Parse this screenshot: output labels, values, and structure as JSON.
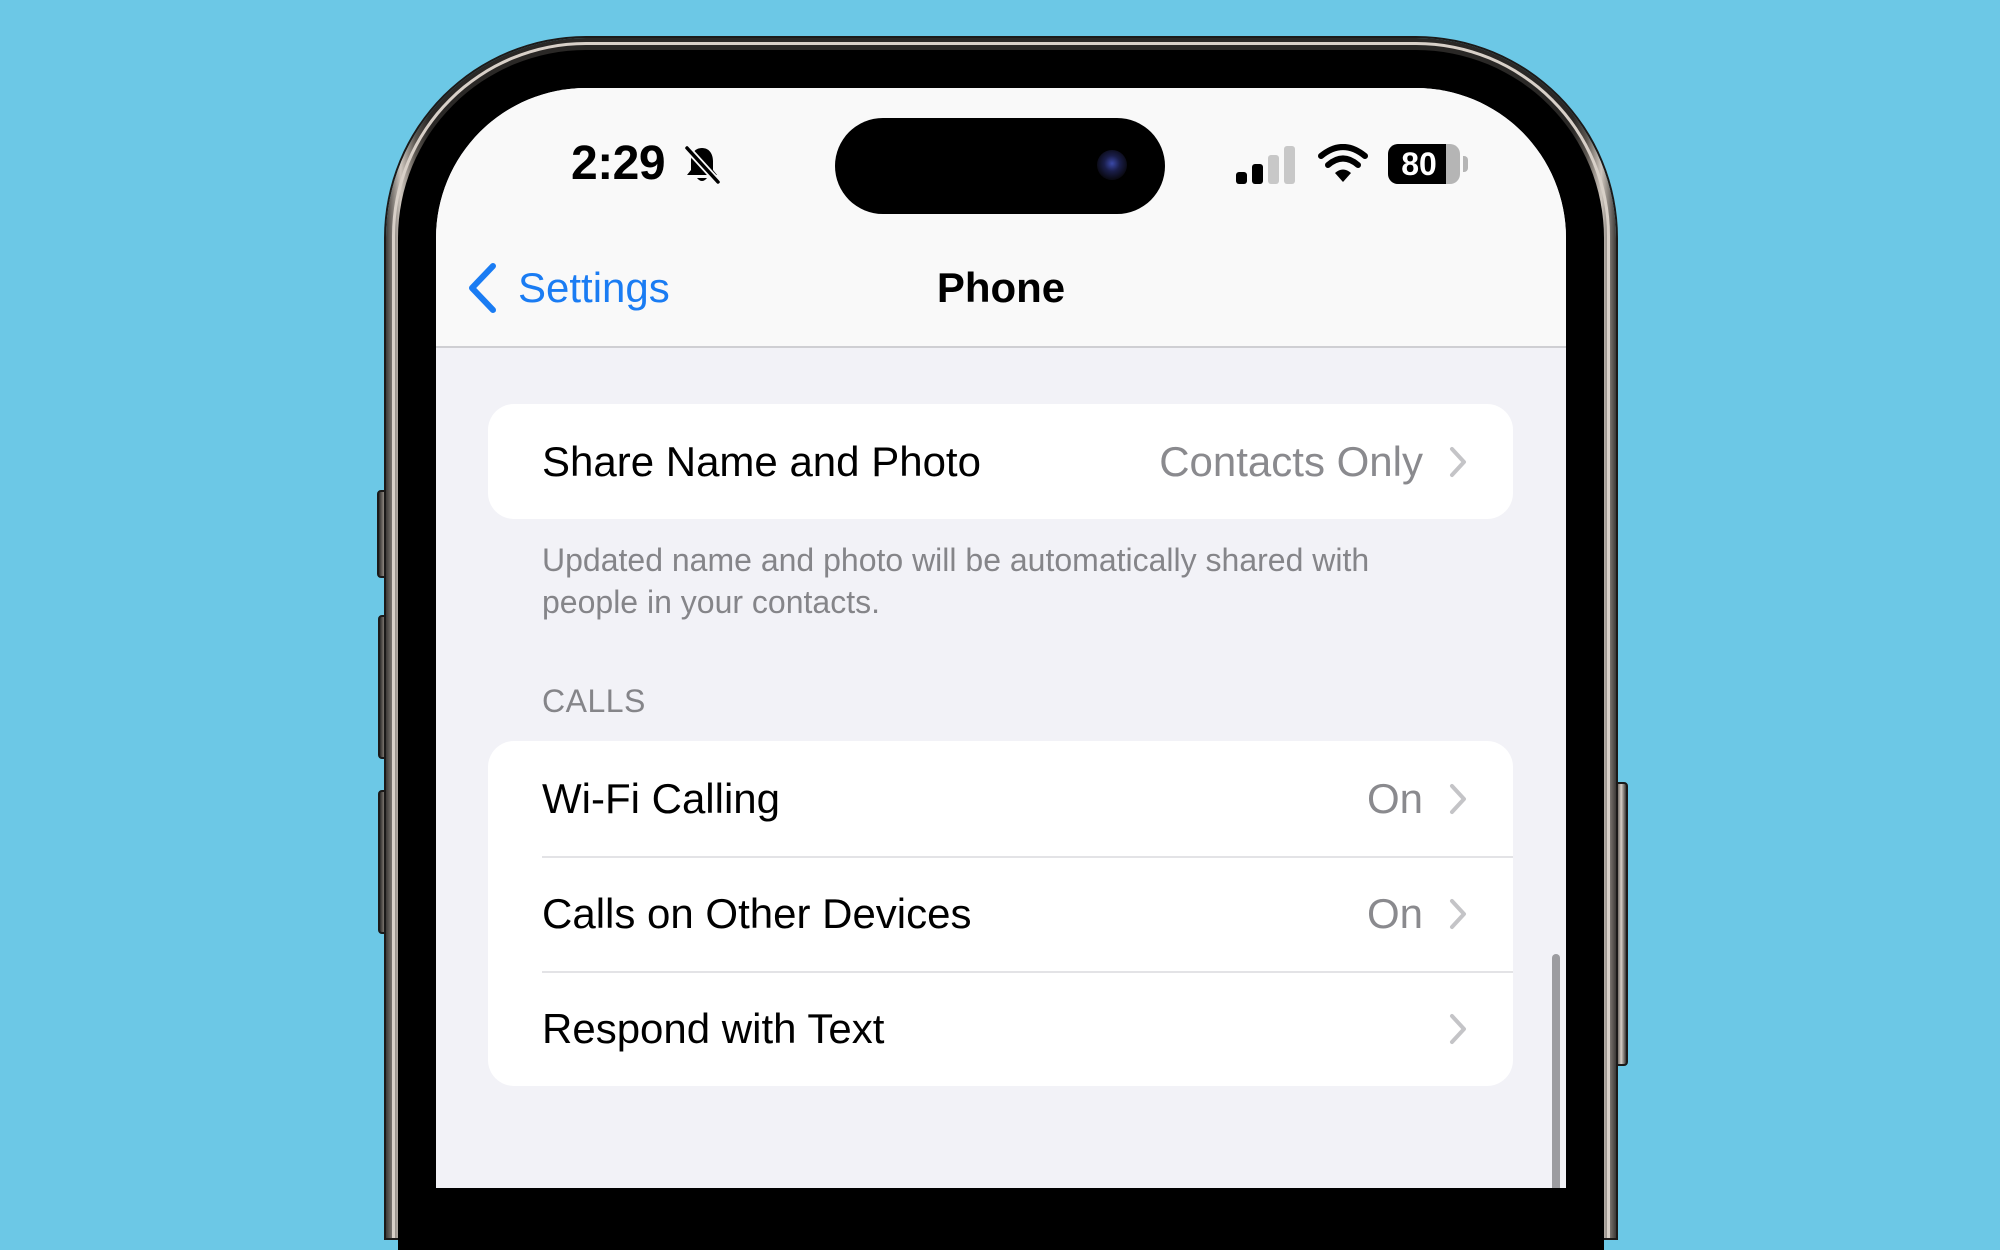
{
  "status_bar": {
    "time": "2:29",
    "silent_icon": "bell-slash-icon",
    "signal_bars_active": 2,
    "signal_bars_total": 4,
    "wifi_icon": "wifi-icon",
    "battery_percent": 80,
    "battery_label": "80"
  },
  "nav": {
    "back_label": "Settings",
    "title": "Phone"
  },
  "share_section": {
    "rows": [
      {
        "label": "Share Name and Photo",
        "value": "Contacts Only"
      }
    ],
    "footer": "Updated name and photo will be automatically shared with people in your contacts."
  },
  "calls_section": {
    "header": "CALLS",
    "rows": [
      {
        "label": "Wi-Fi Calling",
        "value": "On"
      },
      {
        "label": "Calls on Other Devices",
        "value": "On"
      },
      {
        "label": "Respond with Text",
        "value": ""
      }
    ]
  },
  "colors": {
    "background": "#6cc8e6",
    "accent": "#1a7cf3",
    "secondary_text": "#8a8a8e",
    "grouped_background": "#f2f2f7"
  }
}
